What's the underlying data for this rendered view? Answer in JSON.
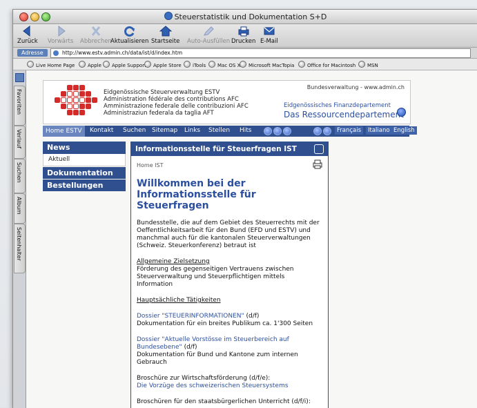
{
  "window": {
    "title": "Steuerstatistik und Dokumentation S+D"
  },
  "toolbar": {
    "back": "Zurück",
    "forward": "Vorwärts",
    "stop": "Abbrechen",
    "reload": "Aktualisieren",
    "home": "Startseite",
    "autofill": "Auto-Ausfüllen",
    "print": "Drucken",
    "email": "E-Mail"
  },
  "address": {
    "label": "Adresse",
    "url": "http://www.estv.admin.ch/data/ist/d/index.htm"
  },
  "favorites": [
    "Live Home Page",
    "Apple",
    "Apple Support",
    "Apple Store",
    "iTools",
    "Mac OS X",
    "Microsoft MacTopia",
    "Office for Macintosh",
    "MSN"
  ],
  "side_tabs": [
    "Favoriten",
    "Verlauf",
    "Suchen",
    "Album",
    "Seitenhalter"
  ],
  "site": {
    "admin_url": "Bundesverwaltung - www.admin.ch",
    "agency_lines": [
      "Eidgenössische Steuerverwaltung ESTV",
      "Administration fédérale des contributions AFC",
      "Amministrazione federale delle contribuzioni AFC",
      "Administraziun federala da taglia AFT"
    ],
    "dept_small": "Eidgenössisches Finanzdepartement",
    "dept_big": "Das Ressourcendepartement"
  },
  "nav": {
    "items": [
      "Home ESTV",
      "Kontakt",
      "Suchen",
      "Sitemap",
      "Links",
      "Stellen",
      "Hits"
    ],
    "languages": [
      "Français",
      "Italiano",
      "English"
    ]
  },
  "left_menu": {
    "news": "News",
    "aktuell": "Aktuell",
    "dokumentation": "Dokumentation",
    "bestellungen": "Bestellungen"
  },
  "panel": {
    "header": "Informationsstelle für Steuerfragen IST",
    "breadcrumb": "Home IST",
    "heading": "Willkommen bei der Informationsstelle für Steuerfragen",
    "intro": "Bundesstelle, die auf dem Gebiet des Steuerrechts mit der Oeffentlichkeitsarbeit für den Bund (EFD und ESTV) und manchmal auch für die kantonalen Steuerverwaltungen (Schweiz. Steuerkonferenz) betraut ist",
    "goal_title": "Allgemeine Zielsetzung",
    "goal_text": "Förderung des gegenseitigen Vertrauens zwischen Steuerverwaltung und Steuerpflichtigen mittels Information",
    "tasks_title": "Hauptsächliche Tätigkeiten",
    "dossier1_link": "Dossier \"STEUERINFORMATIONEN\"",
    "dossier1_lang": " (d/f)",
    "dossier1_text": "Dokumentation für ein breites Publikum ca. 1'300 Seiten",
    "dossier2_link": "Dossier \"Aktuelle Vorstösse im Steuerbereich auf Bundesebene\"",
    "dossier2_lang": " (d/f)",
    "dossier2_text": "Dokumentation für Bund und Kantone zum internen Gebrauch",
    "brochure1_title": "Broschüre zur Wirtschaftsförderung (d/f/e):",
    "brochure1_link": "Die Vorzüge des schweizerischen Steuersystems",
    "brochure2_title": "Broschüren für den staatsbürgerlichen Unterricht (d/f/i):"
  },
  "colors": {
    "swiss_blue": "#2f4f8f",
    "link_blue": "#2b4fa0",
    "logo_red": "#d32a2a"
  }
}
